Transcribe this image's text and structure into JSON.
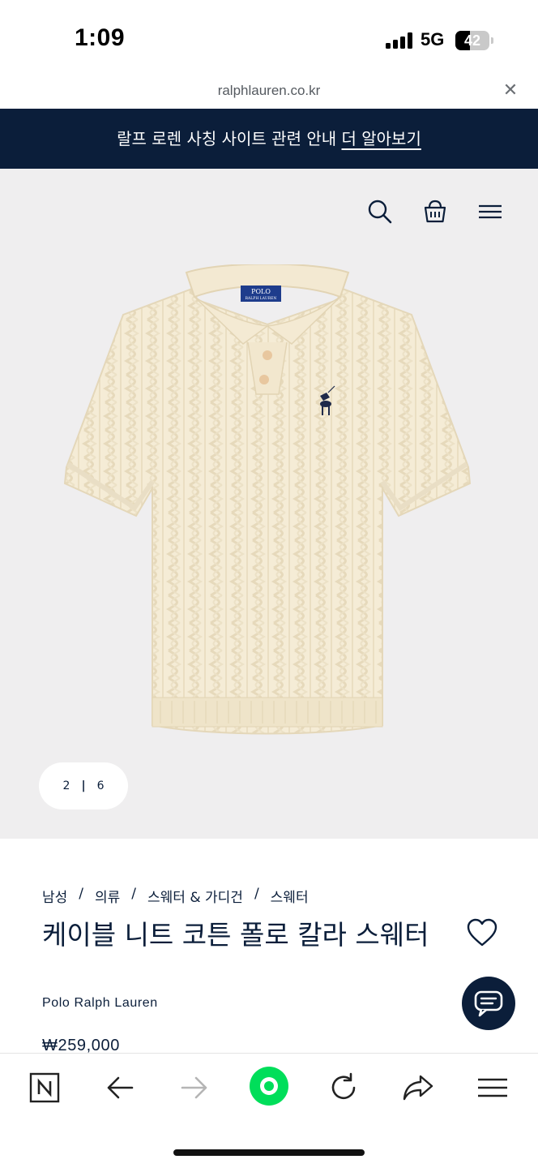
{
  "status_bar": {
    "time": "1:09",
    "network": "5G",
    "battery_level": "42",
    "battery_fraction": 0.42
  },
  "browser": {
    "url": "ralphlauren.co.kr",
    "close_icon": "close-icon"
  },
  "banner": {
    "text": "랄프 로렌 사칭 사이트 관련 안내",
    "link": "더 알아보기",
    "background": "#0b1e3a"
  },
  "header_icons": [
    "search-icon",
    "shopping-bag-icon",
    "menu-icon"
  ],
  "gallery": {
    "current": "2",
    "separator": "|",
    "total": "6"
  },
  "breadcrumb": {
    "items": [
      "남성",
      "의류",
      "스웨터 & 가디건",
      "스웨터"
    ],
    "separator": "/"
  },
  "product": {
    "title": "케이블 니트 코튼 폴로 칼라 스웨터",
    "brand": "Polo Ralph Lauren",
    "price": "₩259,000",
    "logo_label_line1": "POLO",
    "logo_label_line2": "RALPH LAUREN"
  },
  "toolbar": {
    "icons": [
      "naver-home-icon",
      "back-arrow-icon",
      "forward-arrow-icon",
      "green-dot-icon",
      "refresh-icon",
      "share-icon",
      "menu-icon"
    ],
    "accent": "#00de5a"
  }
}
